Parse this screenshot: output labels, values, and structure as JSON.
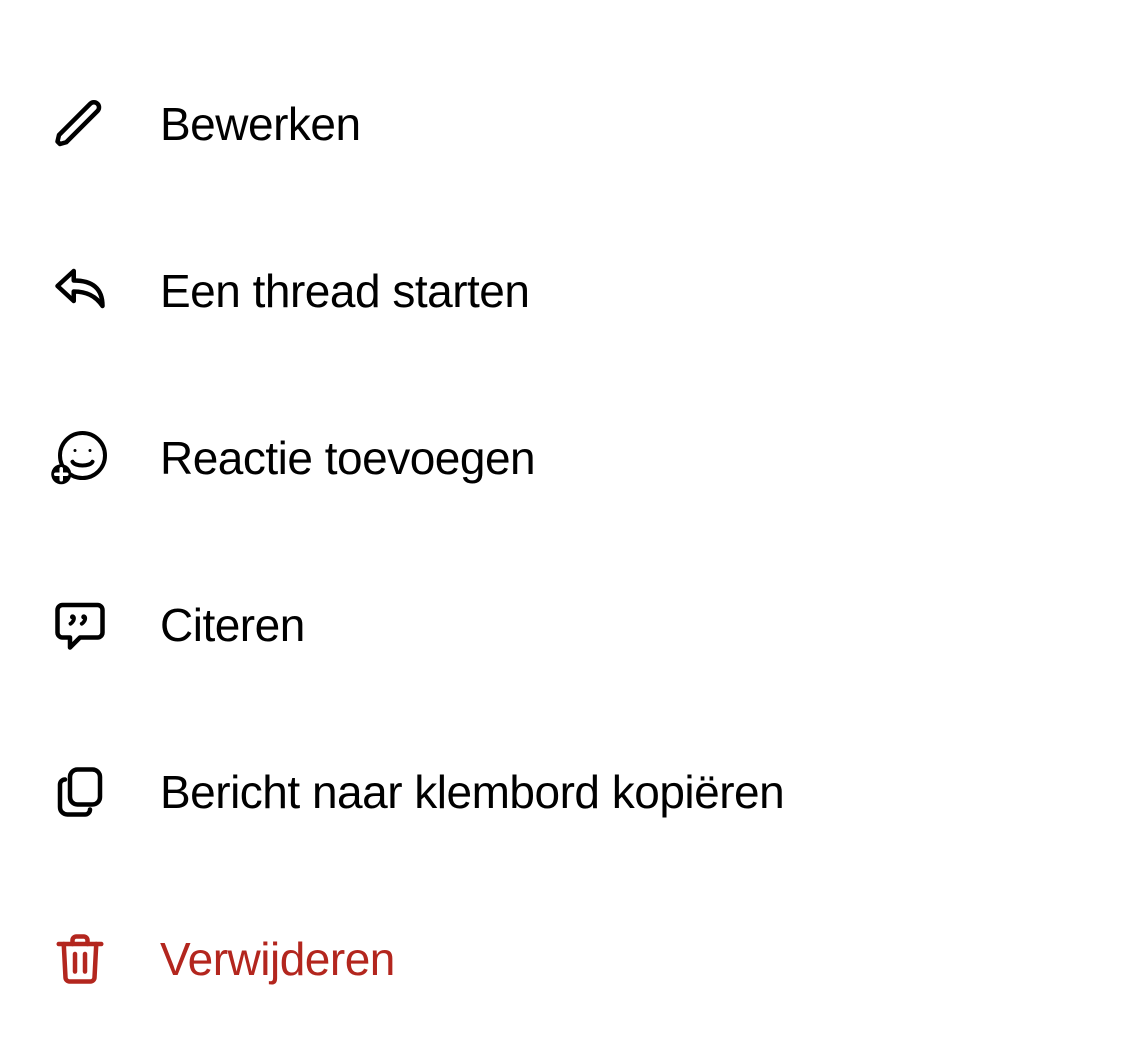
{
  "menu": {
    "items": [
      {
        "label": "Bewerken"
      },
      {
        "label": "Een thread starten"
      },
      {
        "label": "Reactie toevoegen"
      },
      {
        "label": "Citeren"
      },
      {
        "label": "Bericht naar klembord kopiëren"
      },
      {
        "label": "Verwijderen"
      }
    ]
  },
  "colors": {
    "text": "#000000",
    "danger": "#b3261e"
  }
}
